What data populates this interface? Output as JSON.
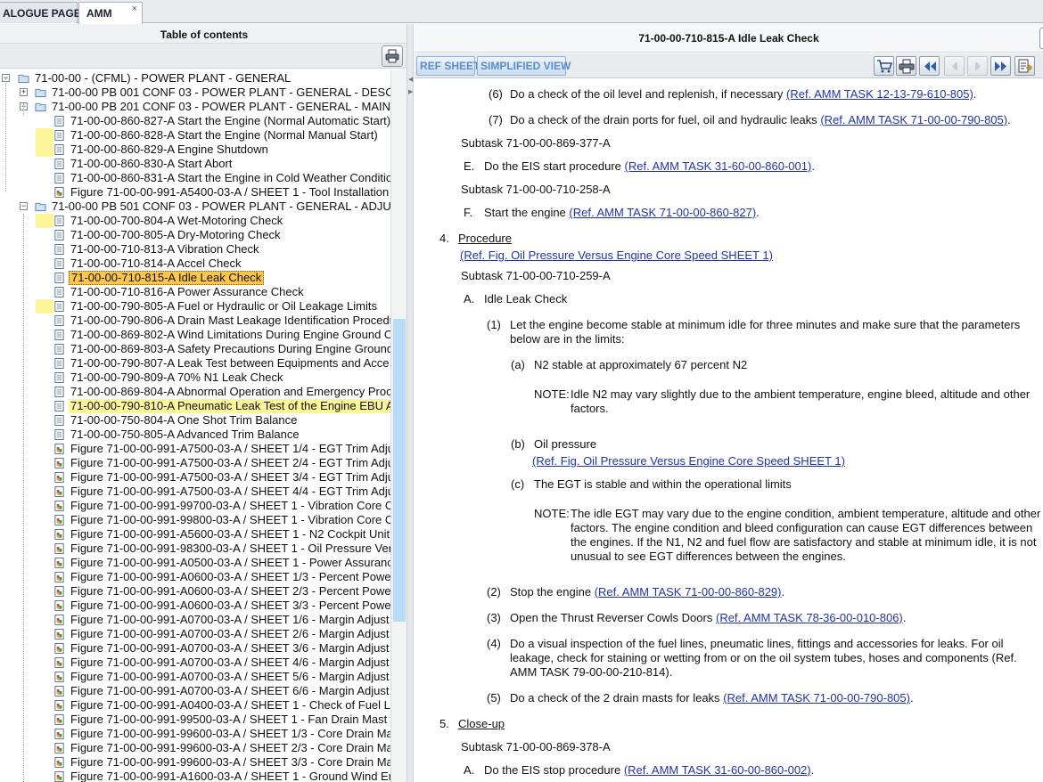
{
  "tabs": [
    {
      "label": "ALOGUE PAGE"
    },
    {
      "label": "AMM",
      "close": "×"
    }
  ],
  "toc": {
    "header": "Table of contents",
    "items": [
      {
        "label": "71-00-00 - (CFML) - POWER PLANT - GENERAL",
        "toggle": "−",
        "icon": "folder-icon"
      },
      {
        "label": "71-00-00 PB 001 CONF 03 - POWER PLANT - GENERAL - DESC",
        "toggle": "+",
        "icon": "folder-icon"
      },
      {
        "label": "71-00-00 PB 201 CONF 03 - POWER PLANT - GENERAL - MAIN",
        "toggle": "−",
        "icon": "folder-icon"
      },
      {
        "label": "71-00-00-860-827-A Start the Engine (Normal Automatic Start)",
        "icon": "document-icon"
      },
      {
        "label": "71-00-00-860-828-A Start the Engine (Normal Manual Start)",
        "icon": "document-icon",
        "marker": true
      },
      {
        "label": "71-00-00-860-829-A Engine Shutdown",
        "icon": "document-icon",
        "marker": true
      },
      {
        "label": "71-00-00-860-830-A Start Abort",
        "icon": "document-icon"
      },
      {
        "label": "71-00-00-860-831-A Start the Engine in Cold Weather Condition",
        "icon": "document-icon"
      },
      {
        "label": "Figure 71-00-00-991-A5400-03-A / SHEET 1 - Tool Installation",
        "icon": "figure-icon"
      },
      {
        "label": "71-00-00 PB 501 CONF 03 - POWER PLANT - GENERAL - ADJU",
        "toggle": "−",
        "icon": "folder-icon"
      },
      {
        "label": "71-00-00-700-804-A Wet-Motoring Check",
        "icon": "document-icon",
        "marker": true
      },
      {
        "label": "71-00-00-700-805-A Dry-Motoring Check",
        "icon": "document-icon"
      },
      {
        "label": "71-00-00-710-813-A Vibration Check",
        "icon": "document-icon"
      },
      {
        "label": "71-00-00-710-814-A Accel Check",
        "icon": "document-icon"
      },
      {
        "label": "71-00-00-710-815-A Idle Leak Check",
        "icon": "document-icon",
        "selected": true
      },
      {
        "label": "71-00-00-710-816-A Power Assurance Check",
        "icon": "document-icon"
      },
      {
        "label": "71-00-00-790-805-A Fuel or Hydraulic or Oil Leakage Limits",
        "icon": "document-icon",
        "marker": true
      },
      {
        "label": "71-00-00-790-806-A Drain Mast Leakage Identification Procedu",
        "icon": "document-icon"
      },
      {
        "label": "71-00-00-869-802-A Wind Limitations During Engine Ground C",
        "icon": "document-icon"
      },
      {
        "label": "71-00-00-869-803-A Safety Precautions During Engine Ground",
        "icon": "document-icon"
      },
      {
        "label": "71-00-00-790-807-A Leak Test between Equipments and Acce",
        "icon": "document-icon"
      },
      {
        "label": "71-00-00-790-809-A 70% N1 Leak Check",
        "icon": "document-icon"
      },
      {
        "label": "71-00-00-869-804-A Abnormal Operation and Emergency Proc",
        "icon": "document-icon"
      },
      {
        "label": "71-00-00-790-810-A Pneumatic Leak Test of the Engine EBU A",
        "icon": "document-icon",
        "highlight": true
      },
      {
        "label": "71-00-00-750-804-A One Shot Trim Balance",
        "icon": "document-icon"
      },
      {
        "label": "71-00-00-750-805-A Advanced Trim Balance",
        "icon": "document-icon"
      },
      {
        "label": "Figure 71-00-00-991-A7500-03-A / SHEET 1/4 - EGT Trim Adju",
        "icon": "figure-icon"
      },
      {
        "label": "Figure 71-00-00-991-A7500-03-A / SHEET 2/4 - EGT Trim Adju",
        "icon": "figure-icon"
      },
      {
        "label": "Figure 71-00-00-991-A7500-03-A / SHEET 3/4 - EGT Trim Adju",
        "icon": "figure-icon"
      },
      {
        "label": "Figure 71-00-00-991-A7500-03-A / SHEET 4/4 - EGT Trim Adju",
        "icon": "figure-icon"
      },
      {
        "label": "Figure 71-00-00-991-99700-03-A / SHEET 1 - Vibration Core C",
        "icon": "figure-icon"
      },
      {
        "label": "Figure 71-00-00-991-99800-03-A / SHEET 1 - Vibration Core C",
        "icon": "figure-icon"
      },
      {
        "label": "Figure 71-00-00-991-A5600-03-A / SHEET 1 - N2 Cockpit Unit",
        "icon": "figure-icon"
      },
      {
        "label": "Figure 71-00-00-991-98300-03-A / SHEET 1 - Oil Pressure Ver",
        "icon": "figure-icon"
      },
      {
        "label": "Figure 71-00-00-991-A0500-03-A / SHEET 1 - Power Assuranc",
        "icon": "figure-icon"
      },
      {
        "label": "Figure 71-00-00-991-A0600-03-A / SHEET 1/3 - Percent Powe",
        "icon": "figure-icon"
      },
      {
        "label": "Figure 71-00-00-991-A0600-03-A / SHEET 2/3 - Percent Powe",
        "icon": "figure-icon"
      },
      {
        "label": "Figure 71-00-00-991-A0600-03-A / SHEET 3/3 - Percent Powe",
        "icon": "figure-icon"
      },
      {
        "label": "Figure 71-00-00-991-A0700-03-A / SHEET 1/6 - Margin Adjust",
        "icon": "figure-icon"
      },
      {
        "label": "Figure 71-00-00-991-A0700-03-A / SHEET 2/6 - Margin Adjust",
        "icon": "figure-icon"
      },
      {
        "label": "Figure 71-00-00-991-A0700-03-A / SHEET 3/6 - Margin Adjust",
        "icon": "figure-icon"
      },
      {
        "label": "Figure 71-00-00-991-A0700-03-A / SHEET 4/6 - Margin Adjust",
        "icon": "figure-icon"
      },
      {
        "label": "Figure 71-00-00-991-A0700-03-A / SHEET 5/6 - Margin Adjust",
        "icon": "figure-icon"
      },
      {
        "label": "Figure 71-00-00-991-A0700-03-A / SHEET 6/6 - Margin Adjust",
        "icon": "figure-icon"
      },
      {
        "label": "Figure 71-00-00-991-A0400-03-A / SHEET 1 - Check of Fuel L",
        "icon": "figure-icon"
      },
      {
        "label": "Figure 71-00-00-991-99500-03-A / SHEET 1 - Fan Drain Mast",
        "icon": "figure-icon"
      },
      {
        "label": "Figure 71-00-00-991-99600-03-A / SHEET 1/3 - Core Drain Ma",
        "icon": "figure-icon"
      },
      {
        "label": "Figure 71-00-00-991-99600-03-A / SHEET 2/3 - Core Drain Ma",
        "icon": "figure-icon"
      },
      {
        "label": "Figure 71-00-00-991-99600-03-A / SHEET 3/3 - Core Drain Ma",
        "icon": "figure-icon"
      },
      {
        "label": "Figure 71-00-00-991-A1600-03-A / SHEET 1 - Ground Wind Er",
        "icon": "figure-icon"
      }
    ]
  },
  "document": {
    "title": "71-00-00-710-815-A Idle Leak Check",
    "toolbar": {
      "ref_sheet": "REF SHEET",
      "simplified_view": "SIMPLIFIED VIEW"
    },
    "lines": [
      {
        "prefix": "(6)",
        "text": "Do a check of the oil level and replenish, if necessary",
        "ref": "(Ref. AMM TASK 12-13-79-610-805)",
        "suffix": "."
      },
      {
        "prefix": "(7)",
        "text": "Do a check of the drain ports for fuel, oil and hydraulic leaks",
        "ref": "(Ref. AMM TASK 71-00-00-790-805)",
        "suffix": "."
      },
      {
        "text": "Subtask 71-00-00-869-377-A"
      },
      {
        "prefix": "E.",
        "text": "Do the EIS start procedure",
        "ref": "(Ref. AMM TASK 31-60-00-860-001)",
        "suffix": "."
      },
      {
        "text": "Subtask 71-00-00-710-258-A"
      },
      {
        "prefix": "F.",
        "text": "Start the engine",
        "ref": "(Ref. AMM TASK 71-00-00-860-827)",
        "suffix": "."
      },
      {
        "prefix": "4.",
        "text": "Procedure"
      },
      {
        "ref": "(Ref. Fig. Oil Pressure Versus Engine Core Speed SHEET 1)"
      },
      {
        "text": "Subtask 71-00-00-710-259-A"
      },
      {
        "prefix": "A.",
        "text": "Idle Leak Check"
      },
      {
        "prefix": "(1)",
        "text": "Let the engine become stable at minimum idle for three minutes and make sure that the parameters below are in the limits:"
      },
      {
        "prefix": "(a)",
        "text": "N2 stable at approximately 67 percent N2"
      },
      {
        "prefix": "NOTE:",
        "text": "Idle N2 may vary slightly due to the ambient temperature, engine bleed, altitude and other factors."
      },
      {
        "prefix": "(b)",
        "text": "Oil pressure"
      },
      {
        "ref": "(Ref. Fig. Oil Pressure Versus Engine Core Speed SHEET 1)"
      },
      {
        "prefix": "(c)",
        "text": "The EGT is stable and within the operational limits"
      },
      {
        "prefix": "NOTE:",
        "text": "The idle EGT may vary due to the engine condition, ambient temperature, altitude and other factors. The engine condition and bleed configuration can cause EGT differences between the engines. If the N1, N2 and fuel flow are satisfactory and stable at minimum idle, it is not unusual to see EGT differences between the engines."
      },
      {
        "prefix": "(2)",
        "text": "Stop the engine",
        "ref": "(Ref. AMM TASK 71-00-00-860-829)",
        "suffix": "."
      },
      {
        "prefix": "(3)",
        "text": "Open the Thrust Reverser Cowls Doors",
        "ref": "(Ref. AMM TASK 78-36-00-010-806)",
        "suffix": "."
      },
      {
        "prefix": "(4)",
        "text": "Do a visual inspection of the fuel lines, pneumatic lines, fittings and accessories for leaks. For oil leakage, check for staining or wetting from or on the oil system tubes, hoses and components",
        "ref": "(Ref. AMM TASK 79-00-00-210-814)",
        "suffix": "."
      },
      {
        "prefix": "(5)",
        "text": "Do a check of the 2 drain masts for leaks",
        "ref": "(Ref. AMM TASK 71-00-00-790-805)",
        "suffix": "."
      },
      {
        "prefix": "5.",
        "text": "Close-up"
      },
      {
        "text": "Subtask 71-00-00-869-378-A"
      },
      {
        "prefix": "A.",
        "text": "Do the EIS stop procedure",
        "ref": "(Ref. AMM TASK 31-60-00-860-002)",
        "suffix": "."
      }
    ]
  }
}
